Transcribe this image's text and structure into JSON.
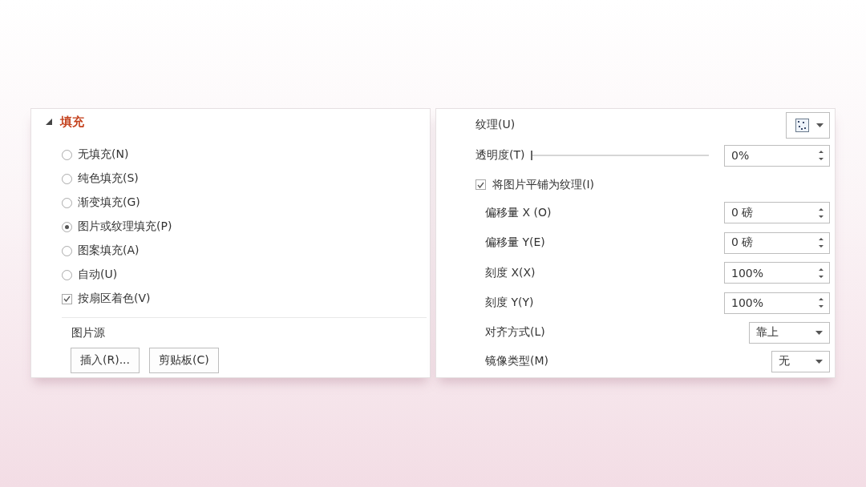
{
  "fill_panel": {
    "section": {
      "title": "填充",
      "expanded": true
    },
    "options": [
      {
        "kind": "radio",
        "label": "无填充(N)",
        "selected": false
      },
      {
        "kind": "radio",
        "label": "纯色填充(S)",
        "selected": false
      },
      {
        "kind": "radio",
        "label": "渐变填充(G)",
        "selected": false
      },
      {
        "kind": "radio",
        "label": "图片或纹理填充(P)",
        "selected": true
      },
      {
        "kind": "radio",
        "label": "图案填充(A)",
        "selected": false
      },
      {
        "kind": "radio",
        "label": "自动(U)",
        "selected": false
      },
      {
        "kind": "checkbox",
        "label": "按扇区着色(V)",
        "checked": true
      }
    ],
    "picture_source": {
      "label": "图片源",
      "buttons": [
        "插入(R)...",
        "剪贴板(C)"
      ]
    }
  },
  "texture_panel": {
    "rows": [
      {
        "kind": "texture",
        "label": "纹理(U)"
      },
      {
        "kind": "slider",
        "label": "透明度(T)",
        "level": 0,
        "value": "0%"
      },
      {
        "kind": "checkbox",
        "label": "将图片平铺为纹理(I)",
        "checked": true
      },
      {
        "kind": "spin",
        "label": "偏移量 X (O)",
        "value": "0 磅"
      },
      {
        "kind": "spin",
        "label": "偏移量 Y(E)",
        "value": "0 磅"
      },
      {
        "kind": "spin",
        "label": "刻度 X(X)",
        "value": "100%"
      },
      {
        "kind": "spin",
        "label": "刻度 Y(Y)",
        "value": "100%"
      },
      {
        "kind": "select",
        "label": "对齐方式(L)",
        "value": "靠上"
      },
      {
        "kind": "select",
        "label": "镜像类型(M)",
        "value": "无"
      }
    ]
  }
}
